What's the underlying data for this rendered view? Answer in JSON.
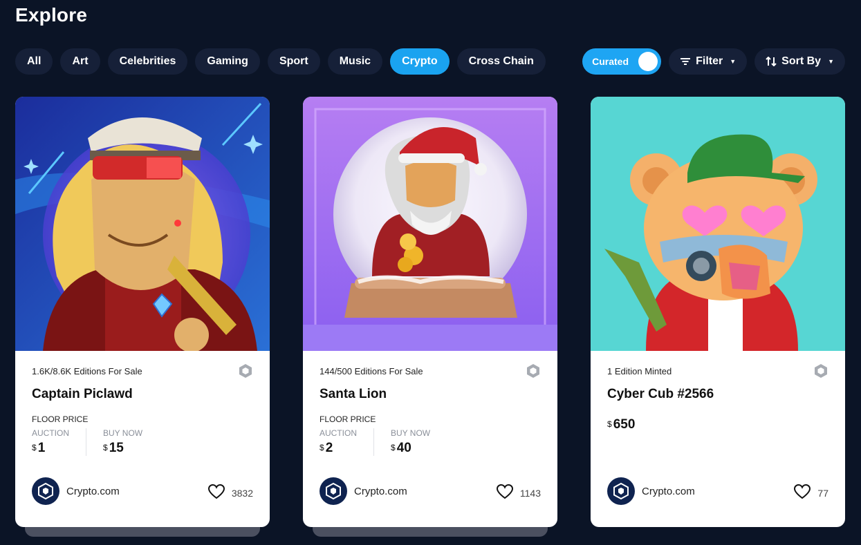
{
  "page": {
    "title": "Explore"
  },
  "categories": [
    "All",
    "Art",
    "Celebrities",
    "Gaming",
    "Sport",
    "Music",
    "Crypto",
    "Cross Chain"
  ],
  "active_category": "Crypto",
  "controls": {
    "curated_label": "Curated",
    "filter_label": "Filter",
    "sort_label": "Sort By"
  },
  "colors": {
    "background": "#0b1426",
    "chip": "#162038",
    "accent": "#1aa3f0"
  },
  "cards": [
    {
      "editions": "1.6K/8.6K Editions For Sale",
      "title": "Captain Piclawd",
      "floor_label": "FLOOR PRICE",
      "auction_label": "AUCTION",
      "auction_currency": "$",
      "auction_value": "1",
      "buy_label": "BUY NOW",
      "buy_currency": "$",
      "buy_value": "15",
      "creator": "Crypto.com",
      "likes": "3832"
    },
    {
      "editions": "144/500 Editions For Sale",
      "title": "Santa Lion",
      "floor_label": "FLOOR PRICE",
      "auction_label": "AUCTION",
      "auction_currency": "$",
      "auction_value": "2",
      "buy_label": "BUY NOW",
      "buy_currency": "$",
      "buy_value": "40",
      "creator": "Crypto.com",
      "likes": "1143"
    },
    {
      "editions": "1 Edition Minted",
      "title": "Cyber Cub #2566",
      "price_currency": "$",
      "price_value": "650",
      "creator": "Crypto.com",
      "likes": "77"
    }
  ]
}
